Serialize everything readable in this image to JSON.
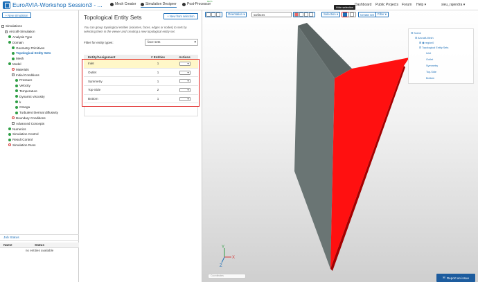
{
  "header": {
    "project_title": "EuroAVIA-Workshop Session3 - ...",
    "tabs": [
      {
        "label": "Mesh Creator"
      },
      {
        "label": "Simulation Designer"
      },
      {
        "label": "Post-Processor"
      }
    ],
    "beta_label": "BETA",
    "links": [
      "Dashboard",
      "Public Projects",
      "Forum",
      "Help"
    ],
    "user": "sieu_rajendra"
  },
  "left_panel": {
    "new_simulation_label": "+ New simulation",
    "tree": [
      {
        "label": "Simulations",
        "status": "plus",
        "indent": 0
      },
      {
        "label": "Aircraft-Simulation",
        "status": "plus",
        "indent": 1
      },
      {
        "label": "Analysis Type",
        "status": "green",
        "indent": 2
      },
      {
        "label": "Domain",
        "status": "green",
        "indent": 2
      },
      {
        "label": "Geometry Primitives",
        "status": "green",
        "indent": 3
      },
      {
        "label": "Topological Entity Sets",
        "status": "green",
        "indent": 3,
        "selected": true
      },
      {
        "label": "Mesh",
        "status": "green",
        "indent": 3
      },
      {
        "label": "Model",
        "status": "green",
        "indent": 2
      },
      {
        "label": "Materials",
        "status": "red",
        "indent": 3
      },
      {
        "label": "Initial Conditions",
        "status": "plus",
        "indent": 3
      },
      {
        "label": "Pressure",
        "status": "green",
        "indent": 4
      },
      {
        "label": "Velocity",
        "status": "green",
        "indent": 4
      },
      {
        "label": "Temperature",
        "status": "green",
        "indent": 4
      },
      {
        "label": "Dynamic viscosity",
        "status": "green",
        "indent": 4
      },
      {
        "label": "k",
        "status": "green",
        "indent": 4
      },
      {
        "label": "Omega",
        "status": "green",
        "indent": 4
      },
      {
        "label": "Turbulent thermal diffusivity",
        "status": "green",
        "indent": 4
      },
      {
        "label": "Boundary Conditions",
        "status": "red",
        "indent": 3
      },
      {
        "label": "Advanced Concepts",
        "status": "plus",
        "indent": 3
      },
      {
        "label": "Numerics",
        "status": "green",
        "indent": 2
      },
      {
        "label": "Simulation Control",
        "status": "green",
        "indent": 2
      },
      {
        "label": "Result Control",
        "status": "green",
        "indent": 2
      },
      {
        "label": "Simulation Runs",
        "status": "red",
        "indent": 2
      }
    ],
    "job_status": {
      "title": "Job Status",
      "col_name": "Name",
      "col_status": "Status",
      "empty_text": "no entities available"
    }
  },
  "middle_panel": {
    "title": "Topological Entity Sets",
    "new_from_selection_label": "+ New from selection",
    "description": "You can group topological entities (volumes, faces, edges or nodes) to sets by selecting them in the viewer and creating a new topological entity set.",
    "filter_label": "Filter for entity types:",
    "filter_value": "face sets",
    "table": {
      "headers": [
        "Entity/Assignment",
        "# Entities",
        "Actions"
      ],
      "rows": [
        {
          "name": "Inlet",
          "count": "1"
        },
        {
          "name": "Outlet",
          "count": "1"
        },
        {
          "name": "Symmetry",
          "count": "1"
        },
        {
          "name": "Top-Side",
          "count": "2"
        },
        {
          "name": "Bottom",
          "count": "1"
        }
      ]
    }
  },
  "viewer": {
    "toolbar": {
      "orientation_label": "Orientation ▾",
      "search_value": "surfaces",
      "selection_label": "Selection ▾",
      "create_set_label": "Create set",
      "filter_label": "Filter ▾"
    },
    "tooltip": "Hide selection",
    "scene_tree": {
      "root": "Scene",
      "mesh": "Aircraft-Mesh",
      "region": "region0",
      "tes_group": "Topological Entity Sets",
      "items": [
        "Inlet",
        "Outlet",
        "Symmetry",
        "Top-Side",
        "Bottom"
      ]
    },
    "axis_labels": {
      "x": "X",
      "y": "Y",
      "z": "Z"
    },
    "coords_placeholder": "Coordinates",
    "colors": {
      "body": "#5f6b69",
      "selected_face": "#ff1010"
    }
  },
  "report_issue_label": "Report an issue"
}
